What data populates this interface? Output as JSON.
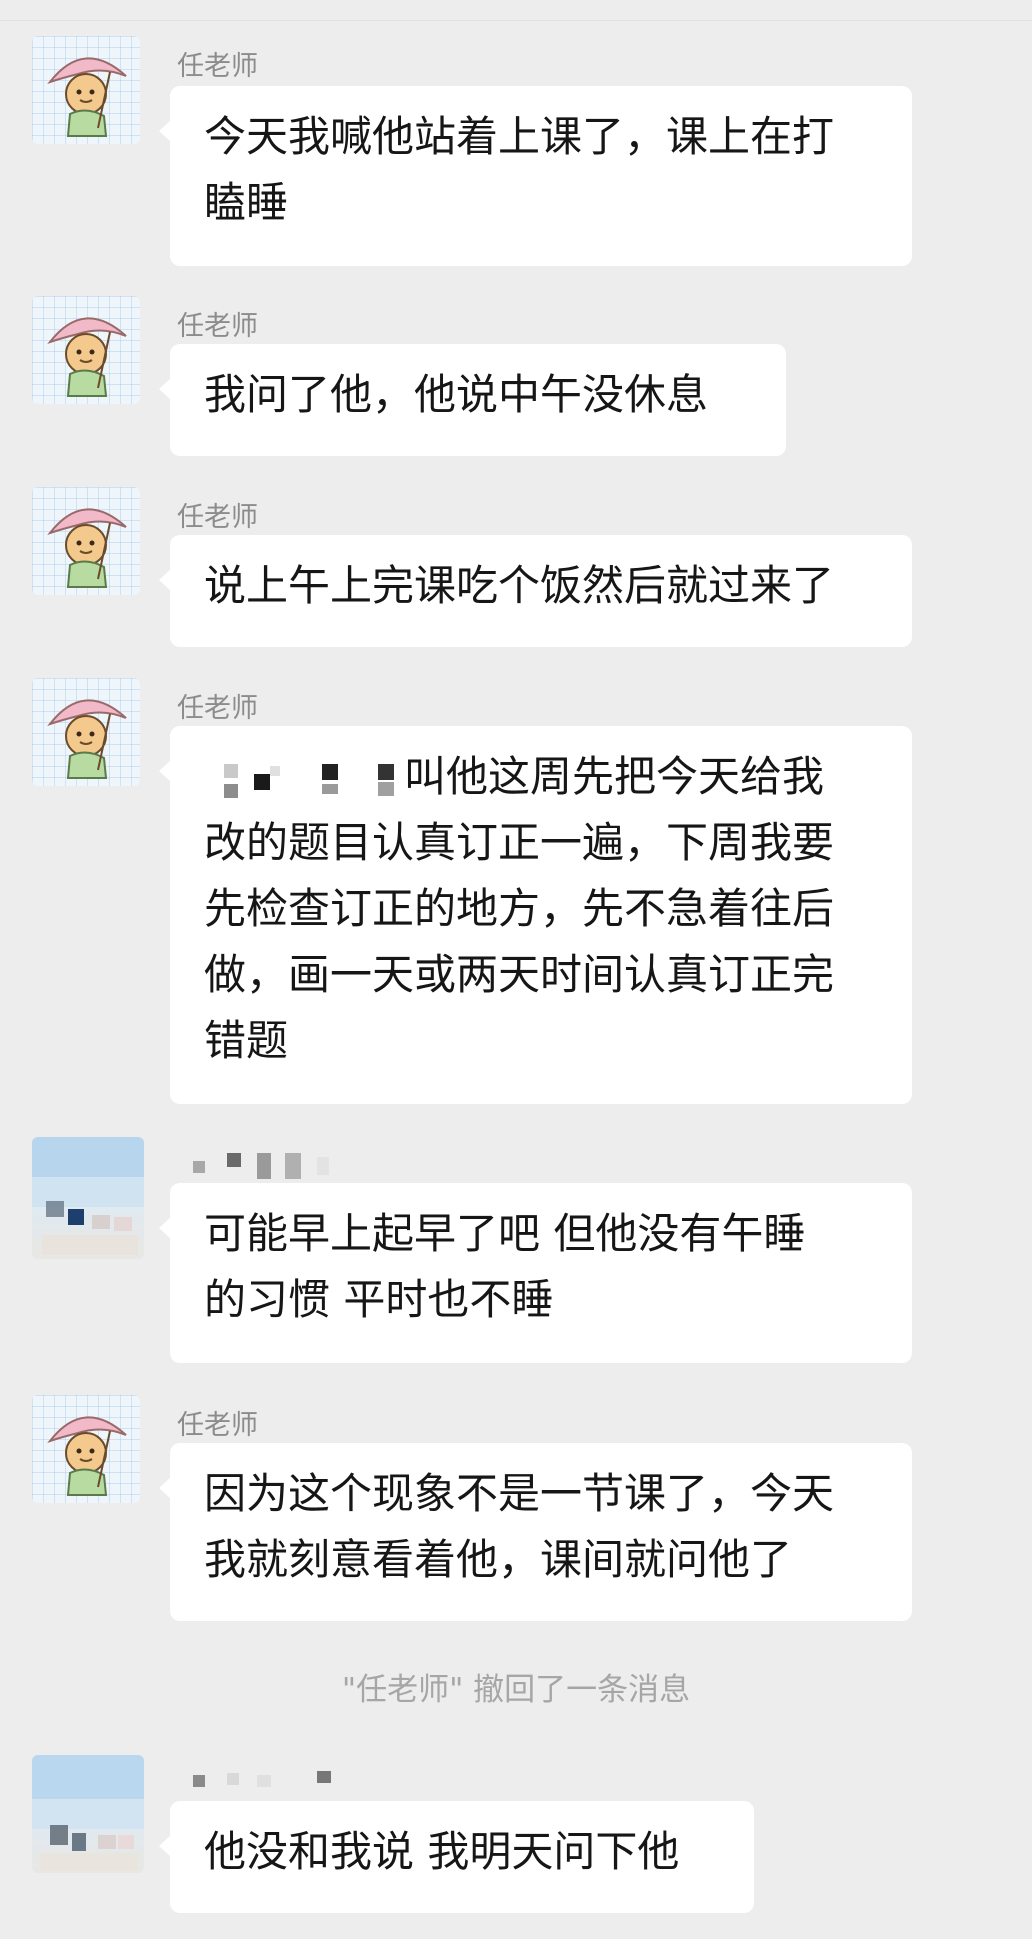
{
  "messages": [
    {
      "sender": "任老师",
      "lines": [
        "今天我喊他站着上课了，课上在打",
        "瞌睡"
      ]
    },
    {
      "sender": "任老师",
      "lines": [
        "我问了他，他说中午没休息"
      ]
    },
    {
      "sender": "任老师",
      "lines": [
        "说上午上完课吃个饭然后就过来了"
      ]
    },
    {
      "sender": "任老师",
      "lines": [
        "叫他这周先把今天给我",
        "改的题目认真订正一遍，下周我要",
        "先检查订正的地方，先不急着往后",
        "做，画一天或两天时间认真订正完",
        "错题"
      ]
    },
    {
      "sender": "",
      "lines": [
        "可能早上起早了吧 但他没有午睡",
        "的习惯 平时也不睡"
      ]
    },
    {
      "sender": "任老师",
      "lines": [
        "因为这个现象不是一节课了，今天",
        "我就刻意看着他，课间就问他了"
      ]
    },
    {
      "sender": "",
      "lines": [
        "他没和我说 我明天问下他"
      ]
    }
  ],
  "system_notice": "\"任老师\" 撤回了一条消息"
}
